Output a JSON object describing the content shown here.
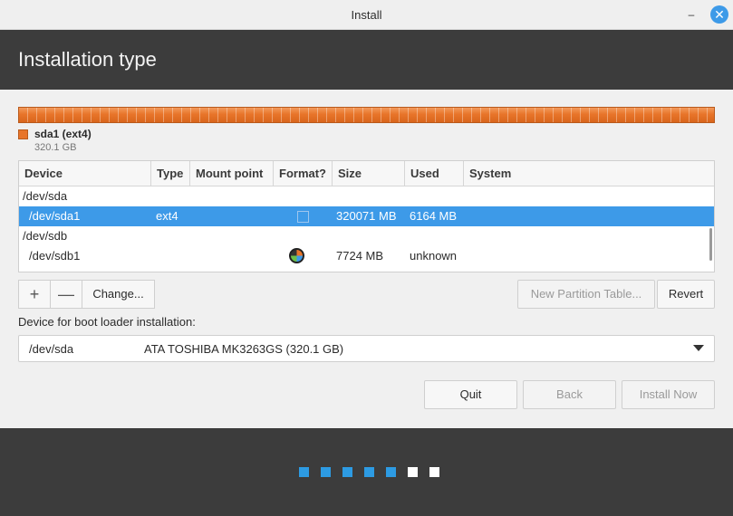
{
  "window": {
    "title": "Install"
  },
  "header": {
    "title": "Installation type"
  },
  "partition_bar": {
    "color": "#e8752a",
    "legend_name": "sda1 (ext4)",
    "legend_size": "320.1 GB"
  },
  "table": {
    "columns": [
      "Device",
      "Type",
      "Mount point",
      "Format?",
      "Size",
      "Used",
      "System"
    ],
    "rows": [
      {
        "device": "/dev/sda",
        "type": "",
        "mount": "",
        "format": "",
        "size": "",
        "used": "",
        "system": ""
      },
      {
        "device": "/dev/sda1",
        "type": "ext4",
        "mount": "",
        "format": "unchecked",
        "size": "320071 MB",
        "used": "6164 MB",
        "system": "",
        "selected": true
      },
      {
        "device": "/dev/sdb",
        "type": "",
        "mount": "",
        "format": "",
        "size": "",
        "used": "",
        "system": ""
      },
      {
        "device": "/dev/sdb1",
        "type": "",
        "mount": "",
        "format": "busy",
        "size": "7724 MB",
        "used": "unknown",
        "system": ""
      }
    ]
  },
  "table_buttons": {
    "add_label": "+",
    "remove_label": "—",
    "change_label": "Change...",
    "new_partition_table_label": "New Partition Table...",
    "revert_label": "Revert"
  },
  "boot_loader": {
    "label": "Device for boot loader installation:",
    "device": "/dev/sda",
    "description": "ATA TOSHIBA MK3263GS (320.1 GB)"
  },
  "actions": {
    "quit_label": "Quit",
    "back_label": "Back",
    "install_label": "Install Now"
  },
  "progress": {
    "total_steps": 7,
    "completed_steps": 5,
    "active_color": "#2d9be3",
    "inactive_color": "#ffffff"
  }
}
